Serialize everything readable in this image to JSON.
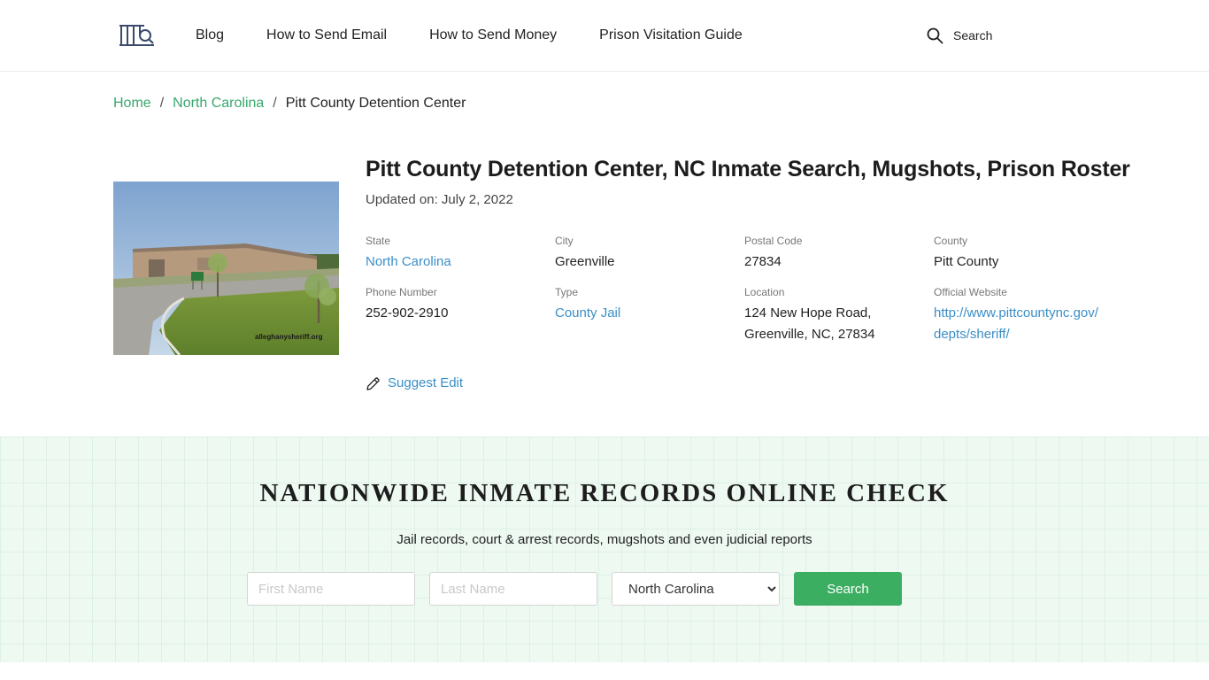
{
  "header": {
    "nav": [
      "Blog",
      "How to Send Email",
      "How to Send Money",
      "Prison Visitation Guide"
    ],
    "search_label": "Search"
  },
  "breadcrumb": {
    "home": "Home",
    "state": "North Carolina",
    "current": "Pitt County Detention Center",
    "separator": "/"
  },
  "facility": {
    "photo_watermark": "alleghanysheriff.org",
    "title": "Pitt County Detention Center, NC Inmate Search, Mugshots, Prison Roster",
    "updated": "Updated on: July 2, 2022",
    "fields": {
      "state": {
        "label": "State",
        "value": "North Carolina"
      },
      "city": {
        "label": "City",
        "value": "Greenville"
      },
      "postal": {
        "label": "Postal Code",
        "value": "27834"
      },
      "county": {
        "label": "County",
        "value": "Pitt County"
      },
      "phone": {
        "label": "Phone Number",
        "value": "252-902-2910"
      },
      "type": {
        "label": "Type",
        "value": "County Jail"
      },
      "location": {
        "label": "Location",
        "line1": "124 New Hope Road,",
        "line2": "Greenville, NC, 27834"
      },
      "website": {
        "label": "Official Website",
        "value": "http://www.pittcountync.gov/depts/sheriff/"
      }
    },
    "suggest_edit": "Suggest Edit"
  },
  "nationwide": {
    "title": "NATIONWIDE INMATE RECORDS ONLINE CHECK",
    "subtitle": "Jail records, court & arrest records, mugshots and even judicial reports",
    "first_name_placeholder": "First Name",
    "last_name_placeholder": "Last Name",
    "state_selected": "North Carolina",
    "search_button": "Search"
  },
  "colors": {
    "link_green": "#3aa76d",
    "link_blue": "#3a8fc7",
    "button_green": "#3cae62",
    "band_bg": "#eef9f2"
  }
}
